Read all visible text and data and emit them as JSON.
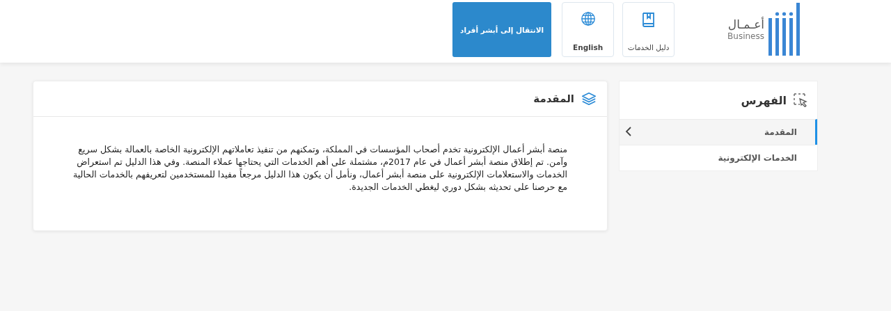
{
  "header": {
    "logo": {
      "arabic": "أعـمـال",
      "latin": "Business"
    },
    "buttons": [
      {
        "kind": "book",
        "label": "دليل الخدمات"
      },
      {
        "kind": "globe",
        "label": "English"
      },
      {
        "kind": "primary",
        "label": "الانتقال إلى أبشر أفراد"
      }
    ]
  },
  "sidebar": {
    "title": "الفهرس",
    "items": [
      {
        "label": "المقدمة",
        "selected": true
      },
      {
        "label": "الخدمات الإلكترونية",
        "selected": false
      }
    ]
  },
  "content": {
    "title": "المقدمة",
    "paragraph": "منصة أبشر أعمال الإلكترونية تخدم أصحاب المؤسسات في المملكة، وتمكنهم من تنفيذ تعاملاتهم الإلكترونية الخاصة بالعمالة بشكل سريع وآمن. تم إطلاق منصة أبشر أعمال في عام 2017م، مشتملة على أهم الخدمات التي يحتاجها عملاء المنصة. وفي هذا الدليل تم استعراض الخدمات والاستعلامات الإلكترونية على منصة أبشر أعمال، ونأمل أن يكون هذا الدليل مرجعاً مفيدا للمستخدمين لتعريفهم بالخدمات الحالية مع حرصنا على تحديثه بشكل دوري ليغطي الخدمات الجديدة."
  }
}
